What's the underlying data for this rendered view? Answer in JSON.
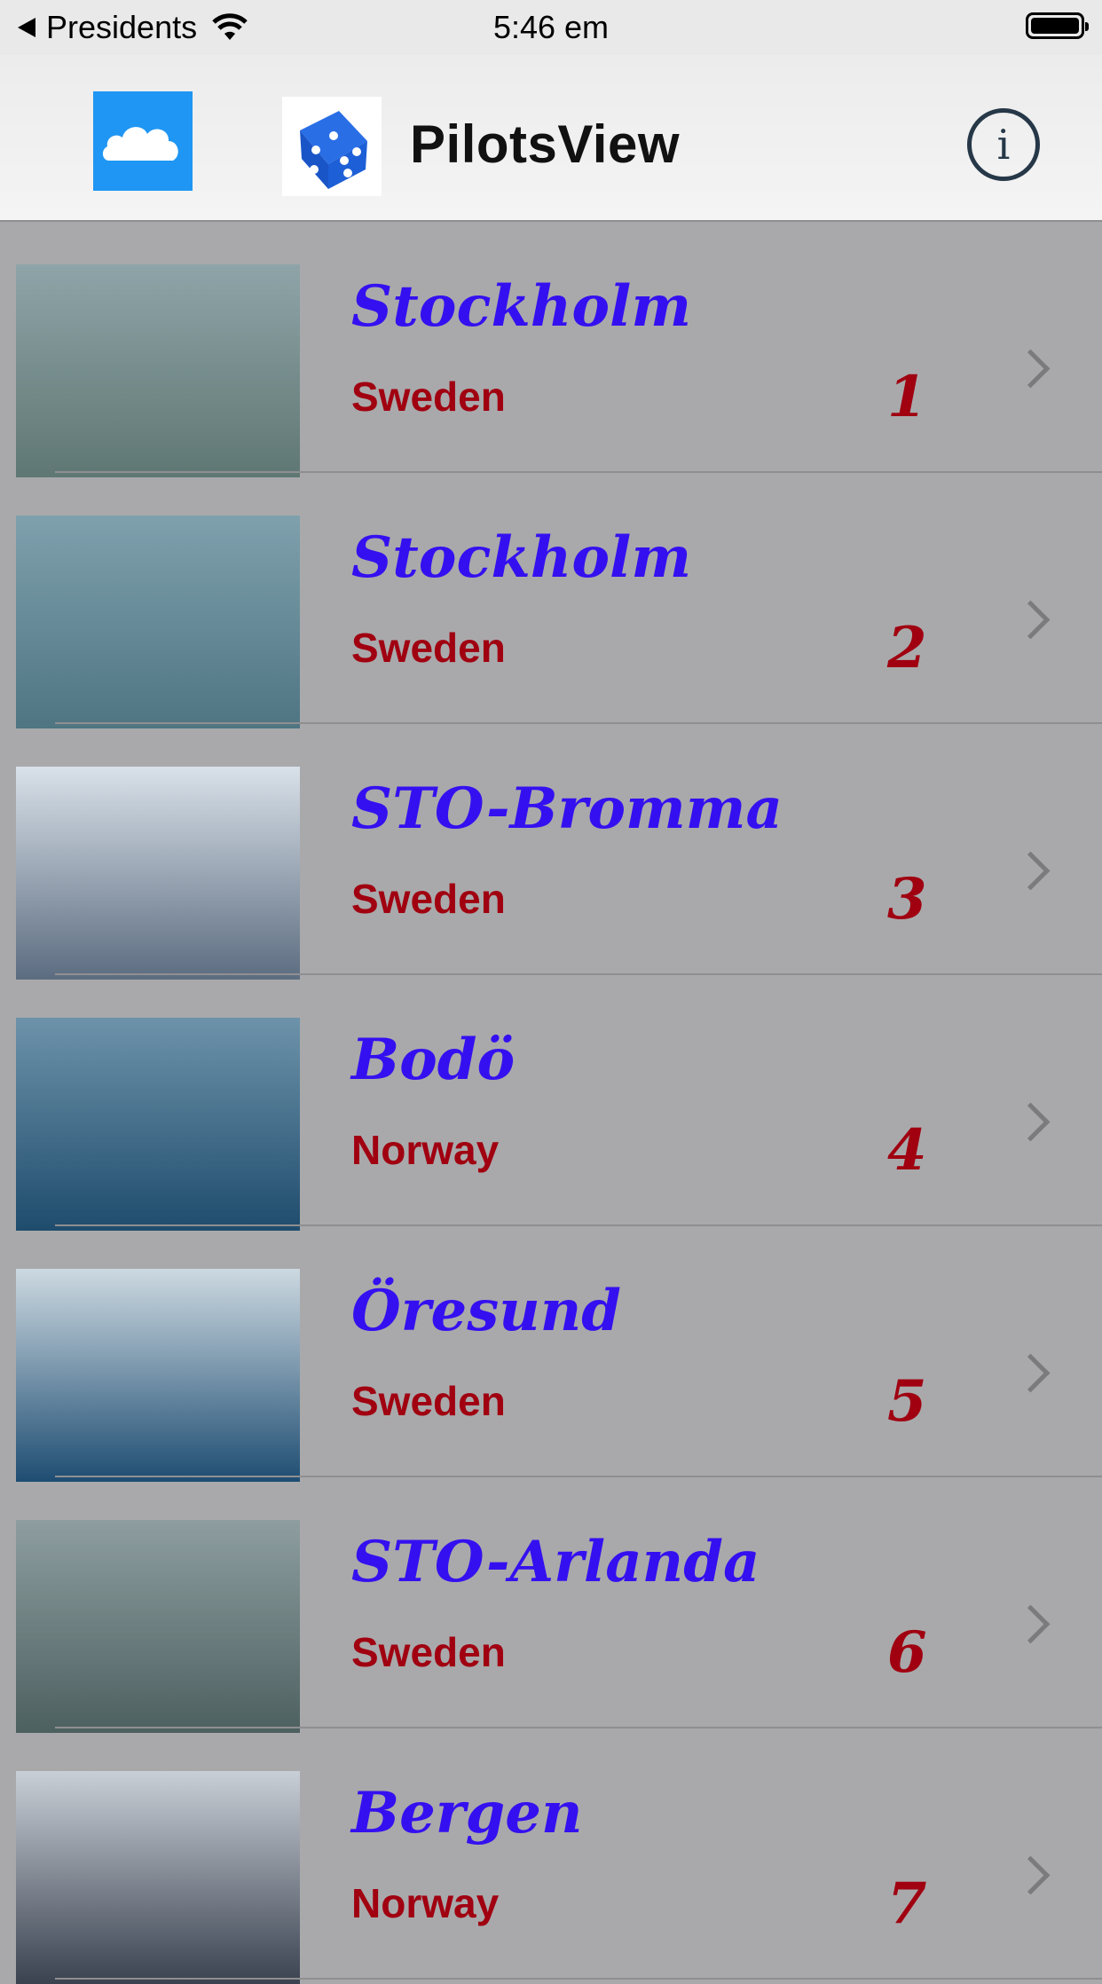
{
  "status_bar": {
    "back_label": "Presidents",
    "time": "5:46 em"
  },
  "nav": {
    "title": "PilotsView"
  },
  "rows": [
    {
      "city": "Stockholm",
      "country": "Sweden",
      "number": "1",
      "sky": "#8fa4a8",
      "land": "#5f7773"
    },
    {
      "city": "Stockholm",
      "country": "Sweden",
      "number": "2",
      "sky": "#7fa0ad",
      "land": "#4f7582"
    },
    {
      "city": "STO-Bromma",
      "country": "Sweden",
      "number": "3",
      "sky": "#d9e1e9",
      "land": "#5c6c80"
    },
    {
      "city": "Bodö",
      "country": "Norway",
      "number": "4",
      "sky": "#6d93aa",
      "land": "#1f4c6d"
    },
    {
      "city": "Öresund",
      "country": "Sweden",
      "number": "5",
      "sky": "#cdd9e1",
      "land": "#1e4d72"
    },
    {
      "city": "STO-Arlanda",
      "country": "Sweden",
      "number": "6",
      "sky": "#8e9ea0",
      "land": "#4d6060"
    },
    {
      "city": "Bergen",
      "country": "Norway",
      "number": "7",
      "sky": "#c8cfd6",
      "land": "#3a4250"
    }
  ]
}
